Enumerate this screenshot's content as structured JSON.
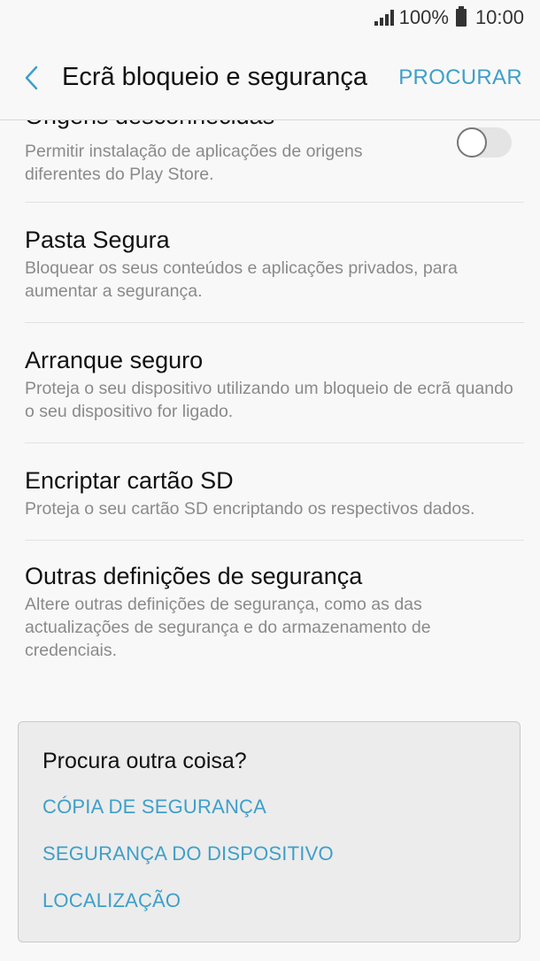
{
  "status_bar": {
    "battery": "100%",
    "time": "10:00"
  },
  "header": {
    "title": "Ecrã bloqueio e segurança",
    "search_label": "PROCURAR"
  },
  "items": [
    {
      "title": "Origens desconhecidas",
      "desc": "Permitir instalação de aplicações de origens diferentes do Play Store.",
      "toggle": false
    },
    {
      "title": "Pasta Segura",
      "desc": "Bloquear os seus conteúdos e aplicações privados, para aumentar a segurança."
    },
    {
      "title": "Arranque seguro",
      "desc": "Proteja o seu dispositivo utilizando um bloqueio de ecrã quando o seu dispositivo for ligado."
    },
    {
      "title": "Encriptar cartão SD",
      "desc": "Proteja o seu cartão SD encriptando os respectivos dados."
    },
    {
      "title": "Outras definições de segurança",
      "desc": "Altere outras definições de segurança, como as das actualizações de segurança e do armazenamento de credenciais."
    }
  ],
  "suggest": {
    "title": "Procura outra coisa?",
    "links": [
      "CÓPIA DE SEGURANÇA",
      "SEGURANÇA DO DISPOSITIVO",
      "LOCALIZAÇÃO"
    ]
  },
  "colors": {
    "accent": "#3e9fc9",
    "background": "#f8f8f8",
    "secondary_text": "#8a8a8a"
  }
}
